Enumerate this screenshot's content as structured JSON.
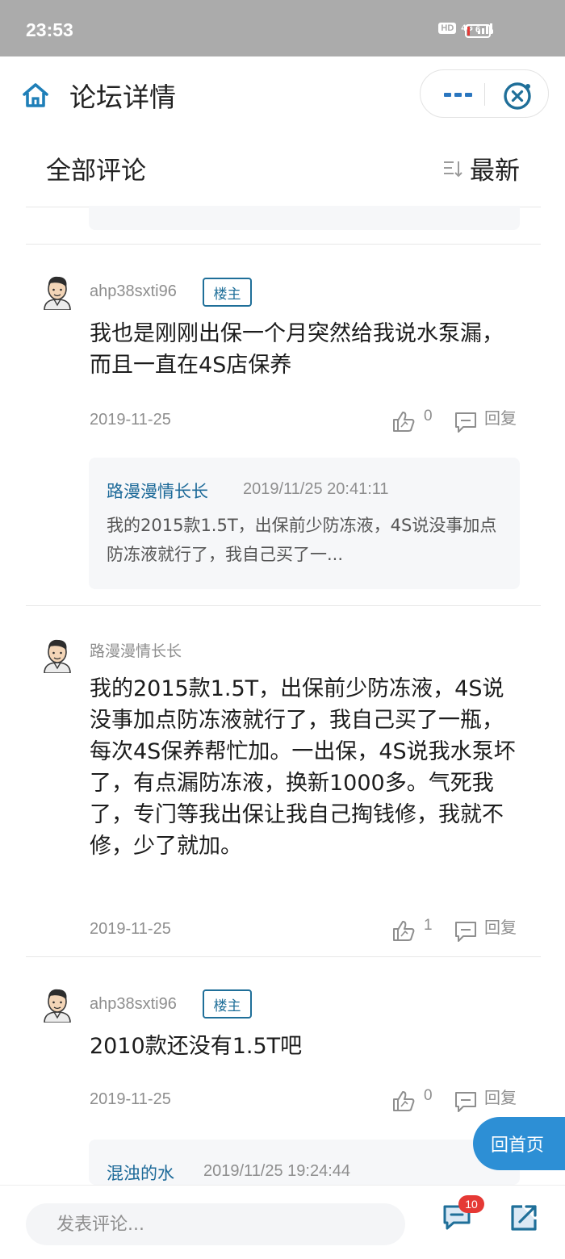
{
  "status_bar": {
    "time": "23:53",
    "hd": "HD",
    "network": "4G",
    "battery": "6"
  },
  "header": {
    "title": "论坛详情"
  },
  "section": {
    "title": "全部评论",
    "sort_label": "最新"
  },
  "comments": [
    {
      "username": "ahp38sxti96",
      "badge": "楼主",
      "content": "我也是刚刚出保一个月突然给我说水泵漏，而且一直在4S店保养",
      "date": "2019-11-25",
      "likes": "0",
      "reply_label": "回复",
      "reply": {
        "name": "路漫漫情长长",
        "time": "2019/11/25 20:41:11",
        "text": "我的2015款1.5T，出保前少防冻液，4S说没事加点防冻液就行了，我自己买了一..."
      }
    },
    {
      "username": "路漫漫情长长",
      "content": "我的2015款1.5T，出保前少防冻液，4S说没事加点防冻液就行了，我自己买了一瓶，每次4S保养帮忙加。一出保，4S说我水泵坏了，有点漏防冻液，换新1000多。气死我了，专门等我出保让我自己掏钱修，我就不修，少了就加。",
      "date": "2019-11-25",
      "likes": "1",
      "reply_label": "回复"
    },
    {
      "username": "ahp38sxti96",
      "badge": "楼主",
      "content": "2010款还没有1.5T吧",
      "date": "2019-11-25",
      "likes": "0",
      "reply_label": "回复",
      "reply": {
        "name": "混浊的水",
        "time": "2019/11/25 19:24:44"
      }
    }
  ],
  "float_button": {
    "label": "回首页"
  },
  "bottom_bar": {
    "input_placeholder": "发表评论...",
    "comment_count": "10"
  },
  "colors": {
    "accent": "#1f6f99",
    "status_bar": "#ababab",
    "float_button": "#2d8fd5",
    "badge_red": "#e53935"
  },
  "icons": [
    "home-icon",
    "more-icon",
    "close-circle-icon",
    "sort-icon",
    "avatar",
    "thumbs-up-icon",
    "reply-icon",
    "comments-icon",
    "share-icon"
  ]
}
